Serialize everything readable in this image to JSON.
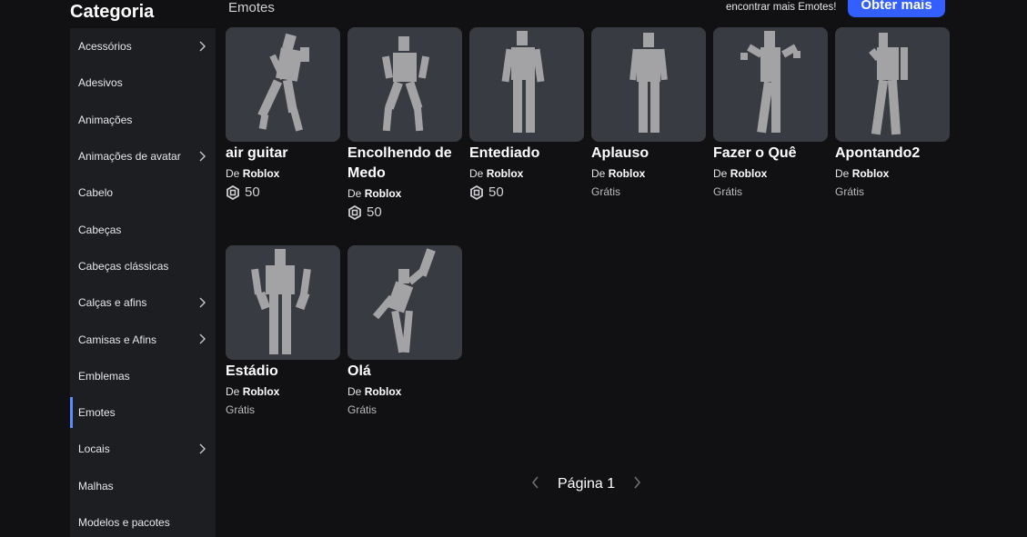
{
  "sidebar": {
    "title": "Categoria",
    "items": [
      {
        "label": "Acessórios",
        "chevron": true
      },
      {
        "label": "Adesivos",
        "chevron": false
      },
      {
        "label": "Animações",
        "chevron": false
      },
      {
        "label": "Animações de avatar",
        "chevron": true
      },
      {
        "label": "Cabelo",
        "chevron": false
      },
      {
        "label": "Cabeças",
        "chevron": false
      },
      {
        "label": "Cabeças clássicas",
        "chevron": false
      },
      {
        "label": "Calças e afins",
        "chevron": true
      },
      {
        "label": "Camisas e Afins",
        "chevron": true
      },
      {
        "label": "Emblemas",
        "chevron": false
      },
      {
        "label": "Emotes",
        "chevron": false,
        "active": true
      },
      {
        "label": "Locais",
        "chevron": true
      },
      {
        "label": "Malhas",
        "chevron": false
      },
      {
        "label": "Modelos e pacotes",
        "chevron": false
      }
    ]
  },
  "header": {
    "section_title": "Emotes",
    "promo_text": "encontrar mais Emotes!",
    "get_more_label": "Obter mais"
  },
  "items": [
    {
      "name": "air guitar",
      "creator_prefix": "De",
      "creator": "Roblox",
      "price": "50",
      "free": ""
    },
    {
      "name": "Encolhendo de Medo",
      "creator_prefix": "De",
      "creator": "Roblox",
      "price": "50",
      "free": ""
    },
    {
      "name": "Entediado",
      "creator_prefix": "De",
      "creator": "Roblox",
      "price": "50",
      "free": ""
    },
    {
      "name": "Aplauso",
      "creator_prefix": "De",
      "creator": "Roblox",
      "price": "",
      "free": "Grátis"
    },
    {
      "name": "Fazer o Quê",
      "creator_prefix": "De",
      "creator": "Roblox",
      "price": "",
      "free": "Grátis"
    },
    {
      "name": "Apontando2",
      "creator_prefix": "De",
      "creator": "Roblox",
      "price": "",
      "free": "Grátis"
    },
    {
      "name": "Estádio",
      "creator_prefix": "De",
      "creator": "Roblox",
      "price": "",
      "free": "Grátis"
    },
    {
      "name": "Olá",
      "creator_prefix": "De",
      "creator": "Roblox",
      "price": "",
      "free": "Grátis"
    }
  ],
  "pager": {
    "label": "Página 1"
  },
  "icons": {
    "currency": "robux-icon",
    "chevron": "chevron-right-icon",
    "prev": "chevron-left-icon",
    "next": "chevron-right-icon"
  },
  "colors": {
    "accent": "#335fff",
    "active_indicator": "#5b8cff",
    "card_bg": "#393b42",
    "sidebar_bg": "#1d1e22",
    "page_bg": "#111114"
  }
}
